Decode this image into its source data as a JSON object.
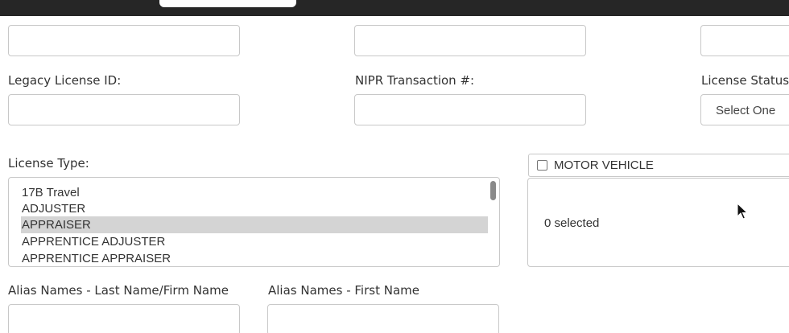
{
  "row1": {
    "input1_value": "",
    "input2_value": "",
    "input3_value": ""
  },
  "row2": {
    "legacy_label": "Legacy License ID:",
    "legacy_value": "",
    "nipr_label": "NIPR Transaction #:",
    "nipr_value": "",
    "status_label": "License Status",
    "status_selected": "Select One"
  },
  "license_type": {
    "label": "License Type:",
    "options": [
      "17B Travel",
      "ADJUSTER",
      "APPRAISER",
      "APPRENTICE ADJUSTER",
      "APPRENTICE APPRAISER"
    ],
    "selected_option": "APPRAISER"
  },
  "line_group": {
    "title": "MOTOR VEHICLE",
    "checked": false,
    "selected_count_text": "0 selected"
  },
  "alias": {
    "last_label": "Alias Names - Last Name/Firm Name",
    "last_value": "",
    "first_label": "Alias Names - First Name",
    "first_value": ""
  },
  "colors": {
    "topbar": "#262626",
    "border": "#c8c8c8",
    "selected_option_bg": "#d4d4d4",
    "text": "#333333"
  }
}
